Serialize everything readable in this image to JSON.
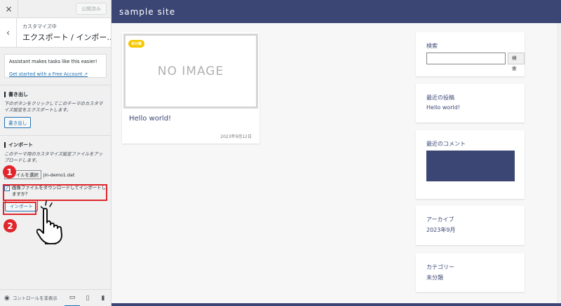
{
  "sidebar": {
    "close_label": "×",
    "publish_label": "公開済み",
    "back_label": "‹",
    "customizing_label": "カスタマイズ中",
    "section_title": "エクスポート / インポー…",
    "assistant": {
      "text": "Assistant makes tasks like this easier!",
      "link": "Get started with a Free Account ↗"
    },
    "export": {
      "title": "書き出し",
      "description": "下のボタンをクリックしてこのテーマのカスタマイズ設定をエクスポートします。",
      "button": "書き出し"
    },
    "import": {
      "title": "インポート",
      "description": "このテーマ用のカスタマイズ設定ファイルをアップロードします。",
      "file_button": "ファイルを選択",
      "file_name": "jin-demo1.dat",
      "checkbox_label": "画像ファイルをダウンロードしてインポートしますか？",
      "checkbox_checked": true,
      "button": "インポート"
    },
    "annotations": {
      "step1": "1",
      "step2": "2"
    },
    "footer": {
      "hide_controls": "コントロールを非表示",
      "devices": [
        "desktop",
        "tablet",
        "mobile"
      ]
    }
  },
  "preview": {
    "site_name": "sample site",
    "post": {
      "category": "未分類",
      "placeholder": "NO IMAGE",
      "title": "Hello world!",
      "date": "2023年9月12日"
    },
    "widgets": {
      "search": {
        "title": "検索",
        "button": "検索"
      },
      "recent_posts": {
        "title": "最近の投稿",
        "item": "Hello world!"
      },
      "recent_comments": {
        "title": "最近のコメント"
      },
      "archives": {
        "title": "アーカイブ",
        "item": "2023年9月"
      },
      "categories": {
        "title": "カテゴリー",
        "item": "未分類"
      }
    }
  },
  "colors": {
    "accent": "#3b4675",
    "annotation_red": "#e0262c",
    "wp_blue": "#2271b1",
    "badge": "#f4c600"
  }
}
